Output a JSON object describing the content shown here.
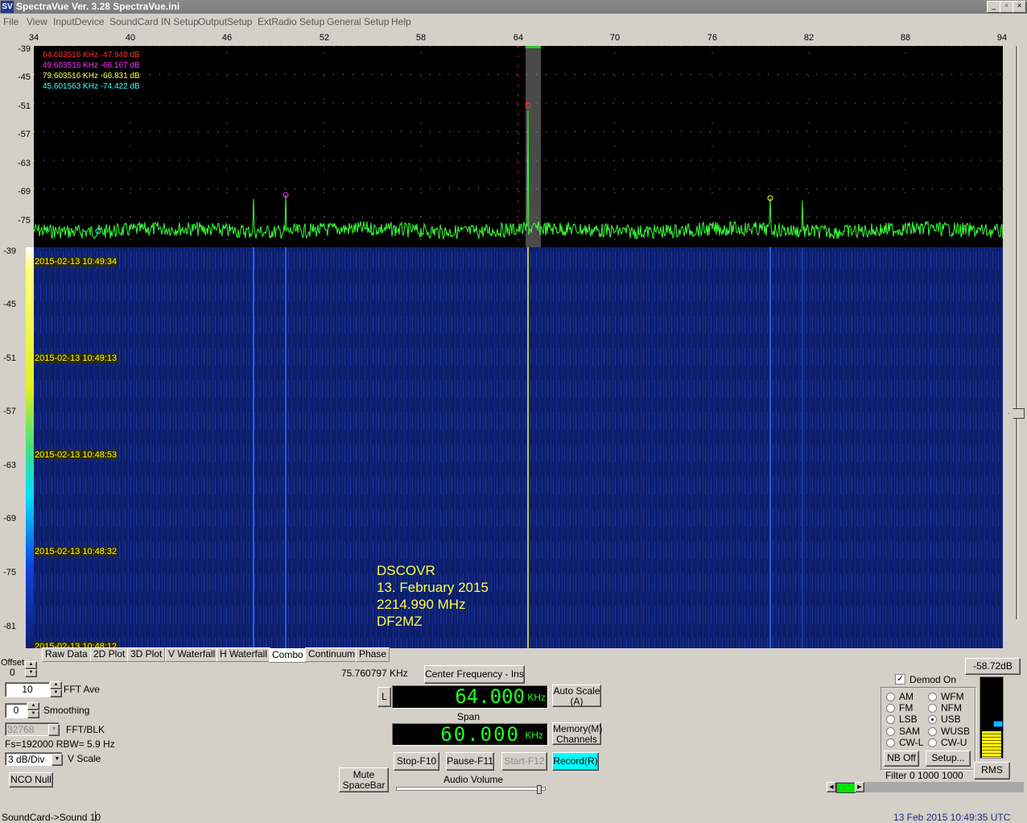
{
  "window": {
    "app_icon": "SV",
    "title": "SpectraVue Ver. 3.28 SpectraVue.ini",
    "controls": [
      "_",
      "▫",
      "×"
    ]
  },
  "menu": [
    "File",
    "View",
    "InputDevice",
    "SoundCard IN Setup",
    "OutputSetup",
    "ExtRadio Setup",
    "General Setup",
    "Help"
  ],
  "plot": {
    "x_ticks": [
      "34",
      "40",
      "46",
      "52",
      "58",
      "64",
      "70",
      "76",
      "82",
      "88",
      "94"
    ],
    "y_ticks_spectrum": [
      "-39",
      "-45",
      "-51",
      "-57",
      "-63",
      "-69",
      "-75"
    ],
    "y_ticks_waterfall": [
      "-39",
      "-45",
      "-51",
      "-57",
      "-63",
      "-69",
      "-75",
      "-81"
    ],
    "markers": [
      {
        "text": "64.603516 KHz  -47.940 dB",
        "color": "#ff3030"
      },
      {
        "text": "49.603516 KHz  -66.167 dB",
        "color": "#ff30ff"
      },
      {
        "text": "79.603516 KHz  -66.831 dB",
        "color": "#ffff40"
      },
      {
        "text": "45.601563 KHz  -74.422 dB",
        "color": "#40ffff"
      }
    ],
    "timestamps": [
      "2015-02-13 10:49:34",
      "2015-02-13 10:49:13",
      "2015-02-13 10:48:53",
      "2015-02-13 10:48:32",
      "2015-02-13 10:48:12"
    ],
    "annotation": [
      "DSCOVR",
      "13. February 2015",
      "2214.990 MHz",
      "DF2MZ"
    ]
  },
  "tabs": [
    "Raw Data",
    "2D Plot",
    "3D Plot",
    "V Waterfall",
    "H Waterfall",
    "Combo",
    "Continuum",
    "Phase"
  ],
  "active_tab": "Combo",
  "left_panel": {
    "offset_label": "Offset",
    "offset_value": "0",
    "fft_ave_value": "10",
    "fft_ave_label": "FFT Ave",
    "smoothing_value": "0",
    "smoothing_label": "Smoothing",
    "fft_blk_value": "32768",
    "fft_blk_label": "FFT/BLK",
    "fs_info": "Fs=192000 RBW= 5.9 Hz",
    "vscale_value": "3 dB/Div",
    "vscale_label": "V Scale",
    "nco_null": "NCO Null"
  },
  "center_panel": {
    "cursor_freq": "75.760797 KHz",
    "center_freq_button": "Center Frequency - Ins",
    "l_button": "L",
    "center_value": "64.000",
    "center_unit": "KHz",
    "auto_scale": "Auto Scale\n(A)",
    "span_label": "Span",
    "span_value": "60.000",
    "span_unit": "KHz",
    "memory": "Memory(M)\nChannels",
    "mute": "Mute\nSpaceBar",
    "stop": "Stop-F10",
    "pause": "Pause-F11",
    "start": "Start-F12",
    "record": "Record(R)",
    "audio_volume": "Audio Volume",
    "audio_volume_level": 0.98
  },
  "right_panel": {
    "level": "-58.72dB",
    "demod_on": "Demod On",
    "modes_left": [
      "AM",
      "FM",
      "LSB",
      "SAM",
      "CW-L"
    ],
    "modes_right": [
      "WFM",
      "NFM",
      "USB",
      "WUSB",
      "CW-U"
    ],
    "selected_mode": "USB",
    "nb_off": "NB Off",
    "setup": "Setup...",
    "rms": "RMS",
    "filter": "Filter  0     1000     1000",
    "meter_level": 0.33
  },
  "status": {
    "left": "SoundCard->Sound 10",
    "right": "13 Feb 2015   10:49:35 UTC"
  },
  "colors": {
    "spectrum_trace": "#39ff39",
    "waterfall_bg": "#0d1f6b",
    "record_active": "#00ffff",
    "lcd_text": "#22ff22"
  }
}
